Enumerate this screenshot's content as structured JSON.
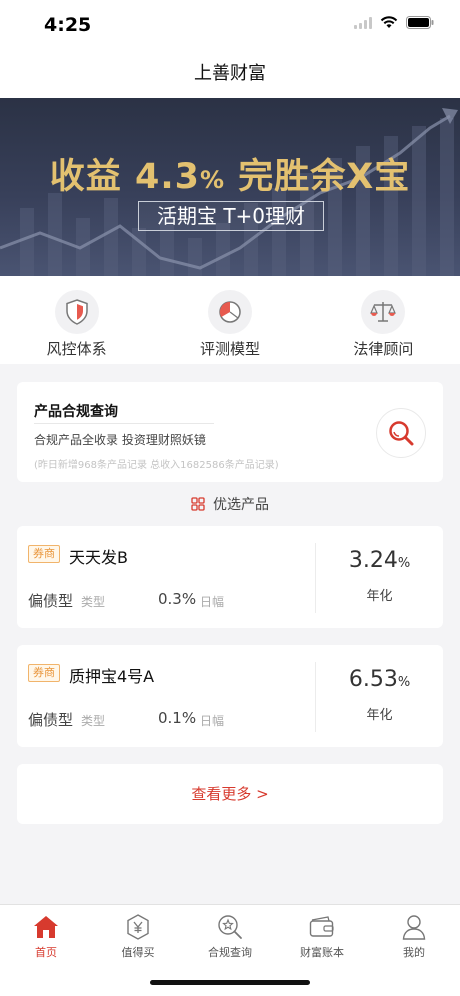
{
  "status_bar": {
    "time": "4:25"
  },
  "nav": {
    "title": "上善财富"
  },
  "banner": {
    "headline_prefix": "收益 4.3",
    "headline_pct": "%",
    "headline_suffix": " 完胜余X宝",
    "subline": "活期宝 T+0理财"
  },
  "quick_links": [
    {
      "label": "风控体系",
      "icon": "shield-icon"
    },
    {
      "label": "评测模型",
      "icon": "pie-chart-icon"
    },
    {
      "label": "法律顾问",
      "icon": "scales-icon"
    }
  ],
  "compliance": {
    "title": "产品合规查询",
    "desc": "合规产品全收录  投资理财照妖镜",
    "note": "(昨日新增968条产品记录  总收入1682586条产品记录)"
  },
  "featured": {
    "label": "优选产品"
  },
  "products": [
    {
      "badge": "券商",
      "name": "天天发B",
      "type": "偏债型",
      "type_label": "类型",
      "change": "0.3%",
      "change_label": "日幅",
      "rate": "3.24",
      "rate_unit": "%",
      "rate_label": "年化"
    },
    {
      "badge": "券商",
      "name": "质押宝4号A",
      "type": "偏债型",
      "type_label": "类型",
      "change": "0.1%",
      "change_label": "日幅",
      "rate": "6.53",
      "rate_unit": "%",
      "rate_label": "年化"
    }
  ],
  "more": {
    "label": "查看更多  >"
  },
  "tabs": [
    {
      "label": "首页",
      "icon": "home-icon",
      "active": true
    },
    {
      "label": "值得买",
      "icon": "yen-hexagon-icon",
      "active": false
    },
    {
      "label": "合规查询",
      "icon": "compliance-search-icon",
      "active": false
    },
    {
      "label": "财富账本",
      "icon": "wallet-icon",
      "active": false
    },
    {
      "label": "我的",
      "icon": "user-icon",
      "active": false
    }
  ],
  "colors": {
    "accent": "#d73a2e",
    "gold": "#e3c170",
    "banner_bg": "#2b3245"
  }
}
